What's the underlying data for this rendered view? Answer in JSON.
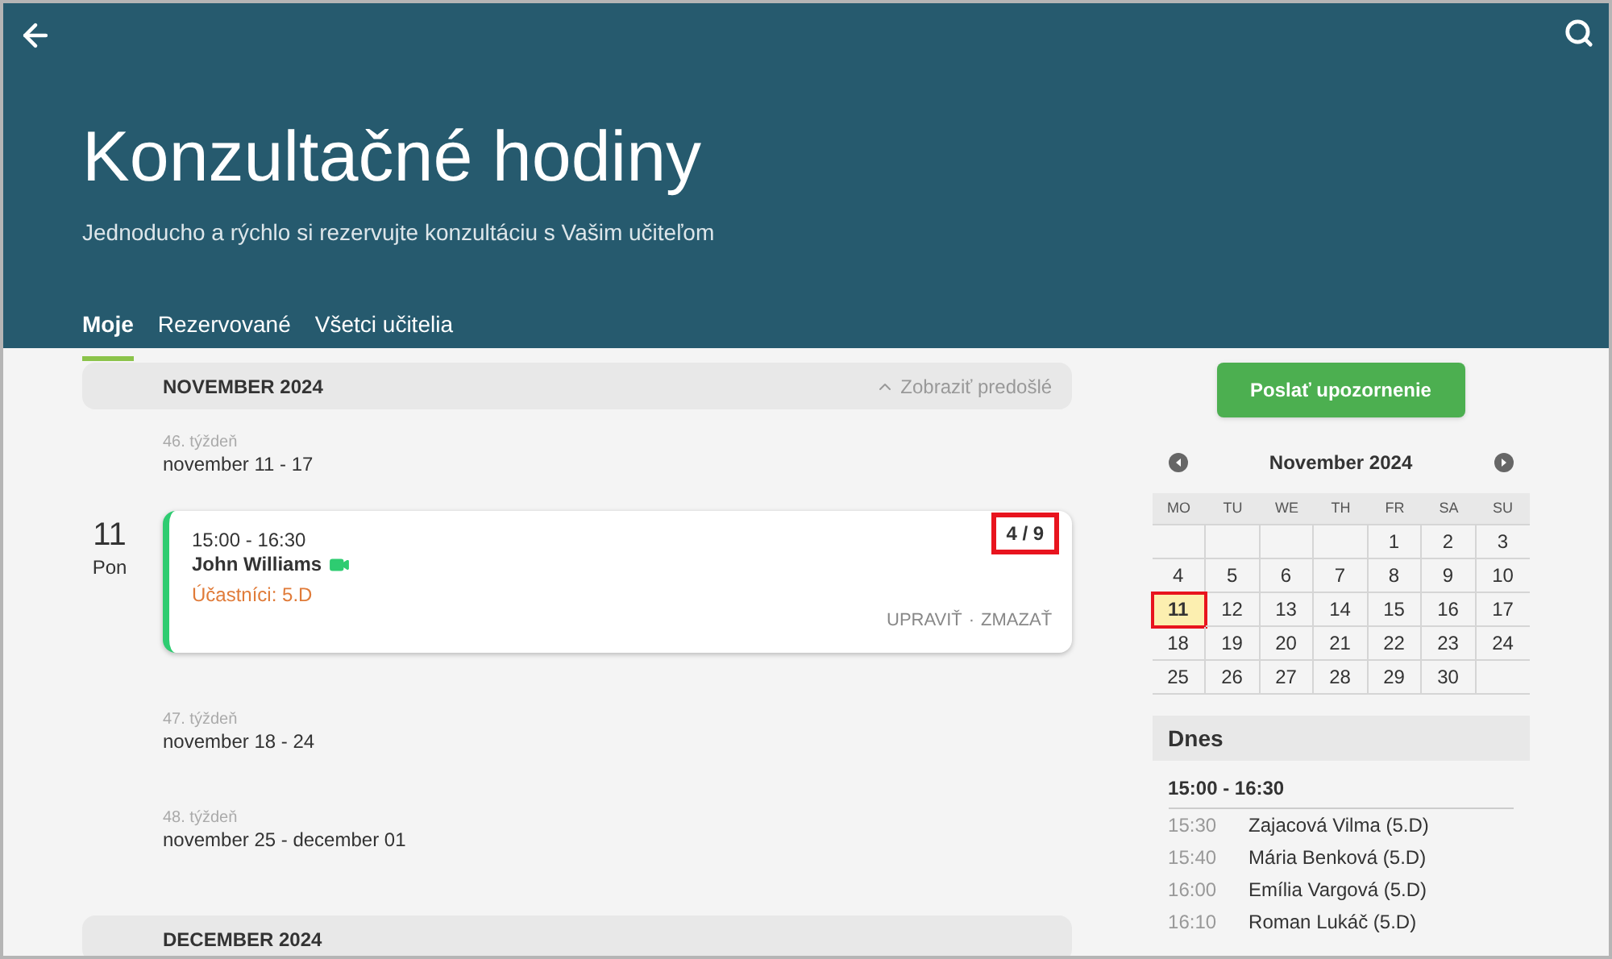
{
  "header": {
    "title": "Konzultačné hodiny",
    "subtitle": "Jednoducho a rýchlo si rezervujte konzultáciu s Vašim učiteľom"
  },
  "tabs": [
    {
      "label": "Moje",
      "selected": true
    },
    {
      "label": "Rezervované",
      "selected": false
    },
    {
      "label": "Všetci učitelia",
      "selected": false
    }
  ],
  "months": [
    {
      "title": "NOVEMBER 2024",
      "show_previous": "Zobraziť predošlé",
      "weeks": [
        {
          "week": "46. týždeň",
          "range": "november 11 - 17",
          "days": [
            {
              "day": "11",
              "weekday": "Pon",
              "events": [
                {
                  "time": "15:00 - 16:30",
                  "teacher": "John Williams",
                  "video": true,
                  "participants": "Účastníci: 5.D",
                  "count": "4 / 9",
                  "highlighted": true,
                  "actions": [
                    "UPRAVIŤ",
                    "ZMAZAŤ"
                  ],
                  "action_separator": "·"
                }
              ]
            }
          ]
        },
        {
          "week": "47. týždeň",
          "range": "november 18 - 24"
        },
        {
          "week": "48. týždeň",
          "range": "november 25 - december 01"
        }
      ]
    },
    {
      "title": "DECEMBER 2024"
    }
  ],
  "notify_button": "Poslať upozornenie",
  "calendar": {
    "title": "November 2024",
    "weekdays": [
      "MO",
      "TU",
      "WE",
      "TH",
      "FR",
      "SA",
      "SU"
    ],
    "weeks": [
      [
        {
          "day": "1",
          "selected": false,
          "highlighted": false
        },
        {
          "day": "2",
          "selected": false,
          "highlighted": false
        },
        {
          "day": "3",
          "selected": false,
          "highlighted": false
        }
      ],
      [
        {
          "day": "4",
          "selected": false,
          "highlighted": false
        },
        {
          "day": "5",
          "selected": false,
          "highlighted": false
        },
        {
          "day": "6",
          "selected": false,
          "highlighted": false
        },
        {
          "day": "7",
          "selected": false,
          "highlighted": false
        },
        {
          "day": "8",
          "selected": false,
          "highlighted": false
        },
        {
          "day": "9",
          "selected": false,
          "highlighted": false
        },
        {
          "day": "10",
          "selected": false,
          "highlighted": false
        }
      ],
      [
        {
          "day": "11",
          "selected": true,
          "highlighted": true
        },
        {
          "day": "12",
          "selected": false,
          "highlighted": false
        },
        {
          "day": "13",
          "selected": false,
          "highlighted": false
        },
        {
          "day": "14",
          "selected": false,
          "highlighted": false
        },
        {
          "day": "15",
          "selected": false,
          "highlighted": false
        },
        {
          "day": "16",
          "selected": false,
          "highlighted": false
        },
        {
          "day": "17",
          "selected": false,
          "highlighted": false
        }
      ],
      [
        {
          "day": "18",
          "selected": false,
          "highlighted": false
        },
        {
          "day": "19",
          "selected": false,
          "highlighted": false
        },
        {
          "day": "20",
          "selected": false,
          "highlighted": false
        },
        {
          "day": "21",
          "selected": false,
          "highlighted": false
        },
        {
          "day": "22",
          "selected": false,
          "highlighted": false
        },
        {
          "day": "23",
          "selected": false,
          "highlighted": false
        },
        {
          "day": "24",
          "selected": false,
          "highlighted": false
        }
      ],
      [
        {
          "day": "25",
          "selected": false,
          "highlighted": false
        },
        {
          "day": "26",
          "selected": false,
          "highlighted": false
        },
        {
          "day": "27",
          "selected": false,
          "highlighted": false
        },
        {
          "day": "28",
          "selected": false,
          "highlighted": false
        },
        {
          "day": "29",
          "selected": false,
          "highlighted": false
        },
        {
          "day": "30",
          "selected": false,
          "highlighted": false
        }
      ]
    ]
  },
  "today": {
    "title": "Dnes",
    "slot": "15:00 - 16:30",
    "bookings": [
      {
        "time": "15:30",
        "name": "Zajacová Vilma (5.D)"
      },
      {
        "time": "15:40",
        "name": "Mária Benková (5.D)"
      },
      {
        "time": "16:00",
        "name": "Emília Vargová (5.D)"
      },
      {
        "time": "16:10",
        "name": "Roman Lukáč (5.D)"
      }
    ]
  }
}
